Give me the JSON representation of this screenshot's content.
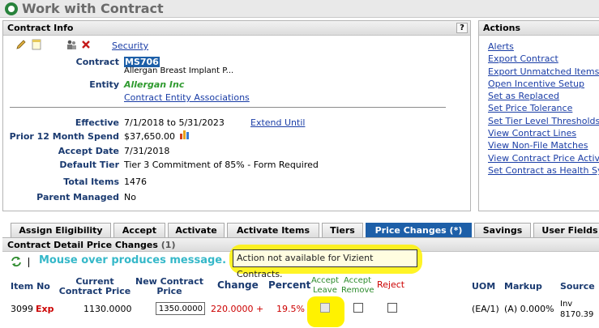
{
  "window": {
    "title": "Work with Contract"
  },
  "contract_info": {
    "header": "Contract Info",
    "help": "?",
    "security_link": "Security",
    "contract_label": "Contract",
    "contract_id": "MS706",
    "contract_name": "Allergan Breast Implant P...",
    "entity_label": "Entity",
    "entity_name": "Allergan Inc",
    "entity_link": "Contract Entity Associations",
    "effective_label": "Effective",
    "effective_value": "7/1/2018 to 5/31/2023",
    "extend_link": "Extend Until",
    "prior_spend_label": "Prior 12 Month Spend",
    "prior_spend_value": "$37,650.00",
    "accept_date_label": "Accept Date",
    "accept_date_value": "7/31/2018",
    "default_tier_label": "Default Tier",
    "default_tier_value": "Tier 3 Commitment of 85% - Form Required",
    "total_items_label": "Total Items",
    "total_items_value": "1476",
    "parent_managed_label": "Parent Managed",
    "parent_managed_value": "No"
  },
  "actions": {
    "header": "Actions",
    "items": [
      "Alerts",
      "Export Contract",
      "Export Unmatched Items",
      "Open Incentive Setup",
      "Set as Replaced",
      "Set Price Tolerance",
      "Set Tier Level Thresholds",
      "View Contract Lines",
      "View Non-File Matches",
      "View Contract Price Activ",
      "Set Contract as Health Sy"
    ]
  },
  "tabs": [
    "Assign Eligibility",
    "Accept",
    "Activate",
    "Activate Items",
    "Tiers",
    "Price Changes (*)",
    "Savings",
    "User Fields"
  ],
  "detail": {
    "header": "Contract Detail Price Changes",
    "count": "(1)",
    "hint": "Mouse over produces message.",
    "tooltip": "Action not available for Vizient Contracts.",
    "columns": {
      "item_no": "Item No",
      "current_price": "Current Contract Price",
      "new_price": "New Contract Price",
      "change": "Change",
      "percent": "Percent",
      "accept_leave": "Accept Leave",
      "accept_remove": "Accept Remove",
      "reject": "Reject",
      "uom": "UOM",
      "markup": "Markup",
      "source": "Source"
    },
    "row": {
      "item_no": "3099",
      "flag": "Exp",
      "current_price": "1130.0000",
      "new_price": "1350.0000",
      "change": "220.0000",
      "change_sign": "+",
      "percent": "19.5%",
      "uom": "(EA/1)",
      "markup": "(A) 0.000%",
      "source": "Inv 8170.39"
    }
  },
  "colors": {
    "label_blue": "#1a3a70",
    "link_blue": "#1a3da6",
    "active_tab": "#1d5fa8",
    "highlight_yellow": "#fff200",
    "hint_cyan": "#35b8c9",
    "negative_red": "#cc0000",
    "accept_green": "#2b8a2b"
  },
  "icons": [
    "pencil-icon",
    "notes-icon",
    "people-icon",
    "delete-icon",
    "chart-icon",
    "refresh-icon"
  ]
}
